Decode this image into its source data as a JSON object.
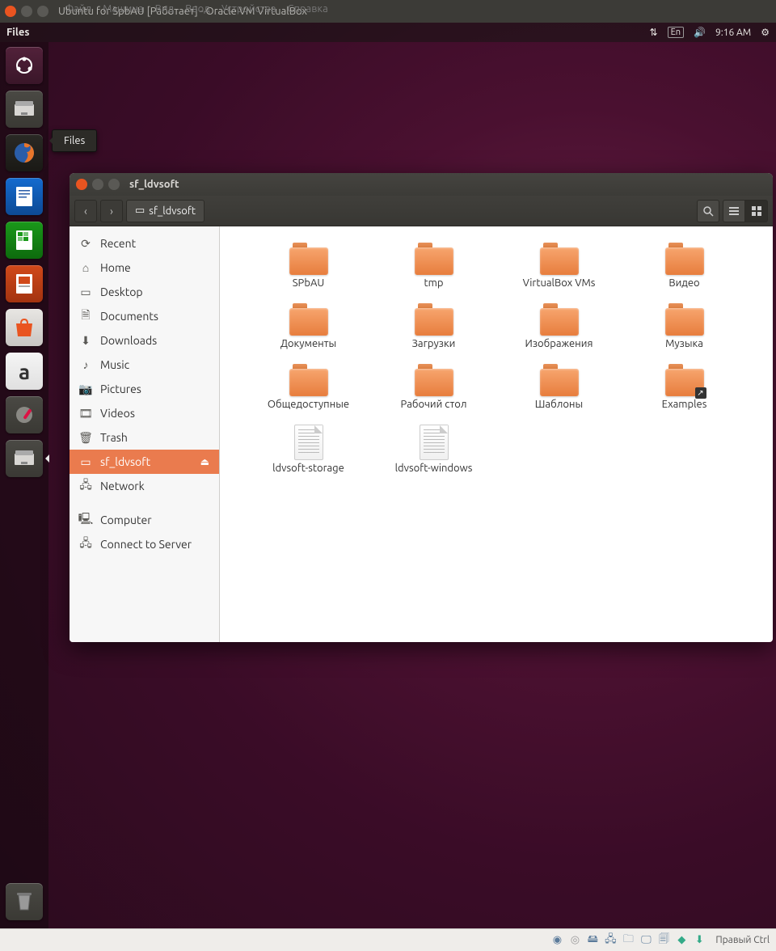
{
  "vm": {
    "title": "Ubuntu for SpbAU [Работает] - Oracle VM VirtualBox",
    "menu": [
      "Файл",
      "Машина",
      "Вид",
      "Ввод",
      "Устройства",
      "Справка"
    ],
    "host_key": "Правый Ctrl"
  },
  "panel": {
    "app": "Files",
    "lang": "En",
    "time": "9:16 AM"
  },
  "launcher": {
    "tooltip": "Files",
    "items": [
      {
        "name": "dash",
        "glyph": "◎"
      },
      {
        "name": "files",
        "glyph": "🗂"
      },
      {
        "name": "firefox",
        "glyph": "🦊"
      },
      {
        "name": "writer",
        "glyph": "📄"
      },
      {
        "name": "calc",
        "glyph": "📊"
      },
      {
        "name": "impress",
        "glyph": "📽"
      },
      {
        "name": "software",
        "glyph": "🛍"
      },
      {
        "name": "amazon",
        "glyph": "a"
      },
      {
        "name": "settings",
        "glyph": "🔧"
      },
      {
        "name": "files2",
        "glyph": "🗂"
      }
    ],
    "trash": "🗑"
  },
  "nautilus": {
    "title": "sf_ldvsoft",
    "path": "sf_ldvsoft",
    "sidebar": [
      {
        "icon": "⟳",
        "label": "Recent"
      },
      {
        "icon": "⌂",
        "label": "Home"
      },
      {
        "icon": "▭",
        "label": "Desktop"
      },
      {
        "icon": "🗎",
        "label": "Documents"
      },
      {
        "icon": "⬇",
        "label": "Downloads"
      },
      {
        "icon": "♪",
        "label": "Music"
      },
      {
        "icon": "📷",
        "label": "Pictures"
      },
      {
        "icon": "🎞",
        "label": "Videos"
      },
      {
        "icon": "🗑",
        "label": "Trash"
      },
      {
        "icon": "▭",
        "label": "sf_ldvsoft",
        "selected": true,
        "eject": true
      },
      {
        "icon": "🖧",
        "label": "Network"
      }
    ],
    "sidebar2": [
      {
        "icon": "🖳",
        "label": "Computer"
      },
      {
        "icon": "🖧",
        "label": "Connect to Server"
      }
    ],
    "items": [
      {
        "type": "folder",
        "label": "SPbAU"
      },
      {
        "type": "folder",
        "label": "tmp"
      },
      {
        "type": "folder",
        "label": "VirtualBox VMs"
      },
      {
        "type": "folder",
        "label": "Видео"
      },
      {
        "type": "folder",
        "label": "Документы"
      },
      {
        "type": "folder",
        "label": "Загрузки"
      },
      {
        "type": "folder",
        "label": "Изображения"
      },
      {
        "type": "folder",
        "label": "Музыка"
      },
      {
        "type": "folder",
        "label": "Общедоступные"
      },
      {
        "type": "folder",
        "label": "Рабочий стол"
      },
      {
        "type": "folder",
        "label": "Шаблоны"
      },
      {
        "type": "folder",
        "label": "Examples",
        "link": true
      },
      {
        "type": "file",
        "label": "ldvsoft-storage"
      },
      {
        "type": "file",
        "label": "ldvsoft-windows"
      }
    ]
  }
}
